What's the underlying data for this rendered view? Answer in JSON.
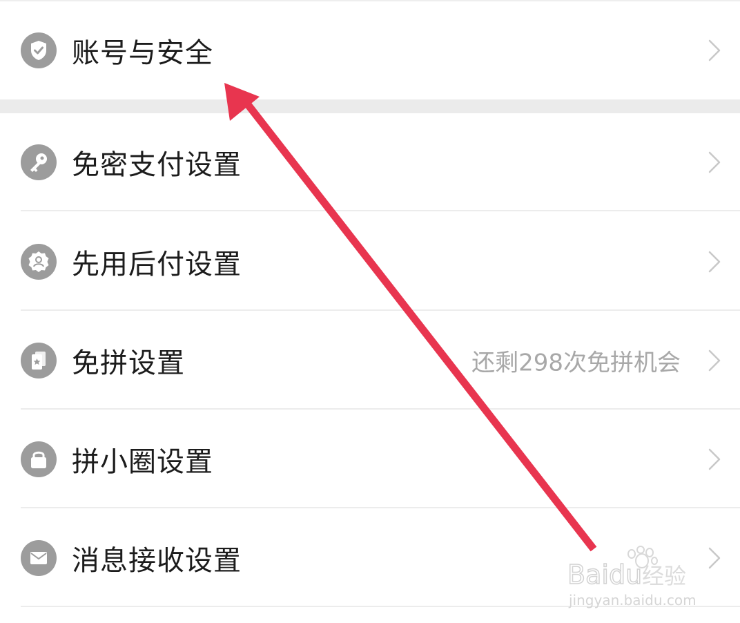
{
  "settings": {
    "items": [
      {
        "label": "账号与安全",
        "icon": "shield-check-icon"
      },
      {
        "label": "免密支付设置",
        "icon": "key-icon"
      },
      {
        "label": "先用后付设置",
        "icon": "badge-person-icon"
      },
      {
        "label": "免拼设置",
        "icon": "cards-star-icon",
        "extra": "还剩298次免拼机会"
      },
      {
        "label": "拼小圈设置",
        "icon": "lock-icon"
      },
      {
        "label": "消息接收设置",
        "icon": "envelope-icon"
      }
    ]
  },
  "annotation": {
    "color": "#e8354f"
  },
  "watermark": {
    "brand": "Baidu经验",
    "url": "jingyan.baidu.com"
  },
  "colors": {
    "icon_bg": "#9c9c9c",
    "separator": "#ebebeb",
    "text": "#1c1c1c",
    "secondary_text": "#a8a8a8"
  }
}
